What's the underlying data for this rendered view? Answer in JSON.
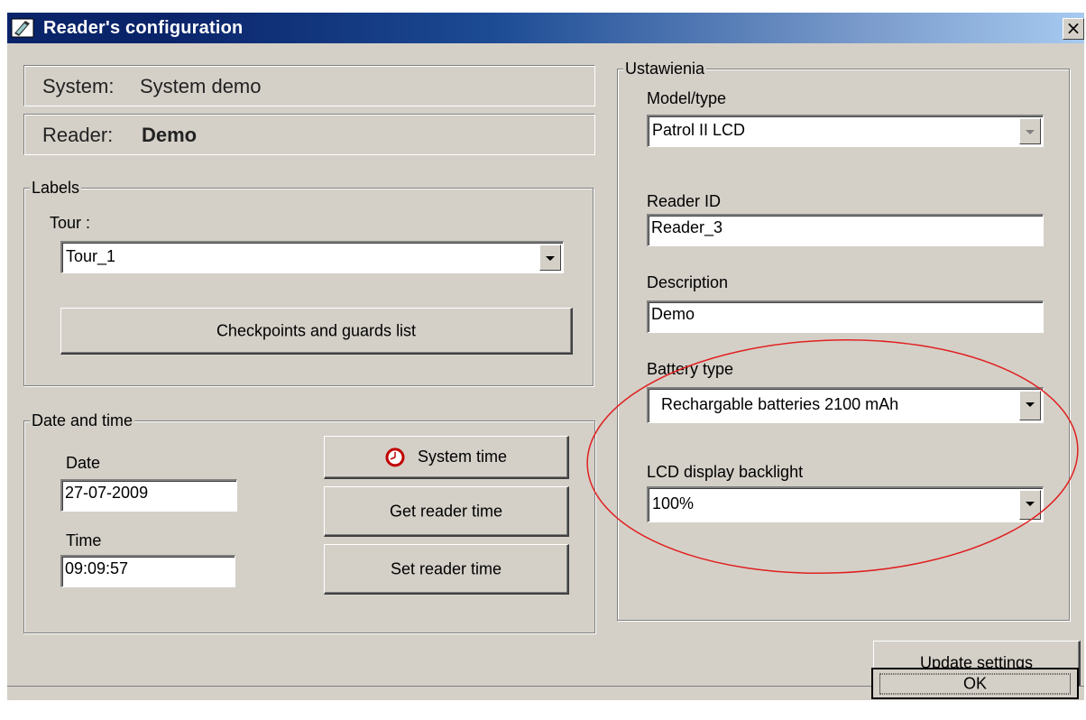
{
  "window": {
    "title": "Reader's configuration",
    "close_glyph": "×"
  },
  "info": {
    "system_label": "System:",
    "system_value": "System demo",
    "reader_label": "Reader:",
    "reader_value": "Demo"
  },
  "labels_group": {
    "legend": "Labels",
    "tour_label": "Tour :",
    "tour_value": "Tour_1",
    "checkpoints_button": "Checkpoints and guards list"
  },
  "datetime_group": {
    "legend": "Date and time",
    "date_label": "Date",
    "date_value": "27-07-2009",
    "time_label": "Time",
    "time_value": "09:09:57",
    "system_time_button": "System time",
    "get_reader_time_button": "Get reader time",
    "set_reader_time_button": "Set reader time"
  },
  "settings_group": {
    "legend": "Ustawienia",
    "model_label": "Model/type",
    "model_value": "Patrol II LCD",
    "reader_id_label": "Reader ID",
    "reader_id_value": "Reader_3",
    "description_label": "Description",
    "description_value": "Demo",
    "battery_label": "Battery type",
    "battery_value": "Rechargable batteries 2100 mAh",
    "backlight_label": "LCD display backlight",
    "backlight_value": "100%"
  },
  "footer": {
    "update_button": "Update settings",
    "ok_button": "OK"
  },
  "icons": {
    "app": "reader-app-icon",
    "clock": "clock-icon"
  },
  "colors": {
    "title_start": "#0a246a",
    "title_end": "#a6caf0",
    "window_bg": "#d4d0c8",
    "annotation": "#e02020"
  }
}
